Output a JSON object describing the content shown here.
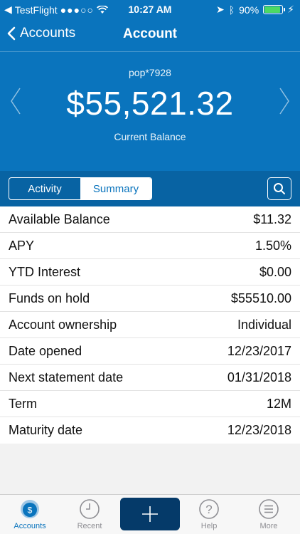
{
  "status_bar": {
    "carrier": "TestFlight",
    "time": "10:27 AM",
    "battery": "90%"
  },
  "nav": {
    "back_label": "Accounts",
    "title": "Account"
  },
  "account": {
    "id": "pop*7928",
    "balance": "$55,521.32",
    "balance_label": "Current Balance"
  },
  "segments": {
    "activity": "Activity",
    "summary": "Summary"
  },
  "details": [
    {
      "label": "Available Balance",
      "value": "$11.32"
    },
    {
      "label": "APY",
      "value": "1.50%"
    },
    {
      "label": "YTD Interest",
      "value": "$0.00"
    },
    {
      "label": "Funds on hold",
      "value": "$55510.00"
    },
    {
      "label": "Account ownership",
      "value": "Individual"
    },
    {
      "label": "Date opened",
      "value": "12/23/2017"
    },
    {
      "label": "Next statement date",
      "value": "01/31/2018"
    },
    {
      "label": "Term",
      "value": "12M"
    },
    {
      "label": "Maturity date",
      "value": "12/23/2018"
    }
  ],
  "tabbar": {
    "accounts": "Accounts",
    "recent": "Recent",
    "help": "Help",
    "more": "More",
    "accounts_icon_glyph": "$",
    "help_icon_glyph": "?"
  },
  "colors": {
    "brand": "#0a74bd",
    "toolbar": "#0863a3",
    "add_button": "#053a69"
  }
}
